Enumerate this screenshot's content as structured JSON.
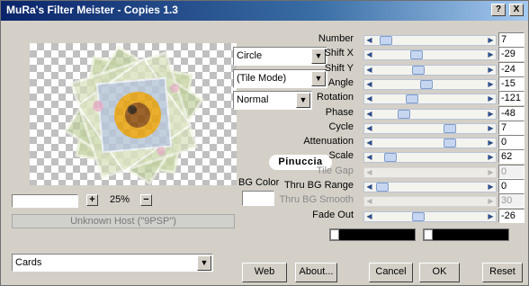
{
  "window": {
    "title": "MuRa's Filter Meister - Copies 1.3"
  },
  "titlebar_buttons": {
    "help": "?",
    "close": "X"
  },
  "zoom": {
    "plus": "+",
    "value": "25%",
    "minus": "−"
  },
  "host_status": "Unknown Host (\"9PSP\")",
  "shape_select": {
    "value": "Circle"
  },
  "mode_select": {
    "value": "(Tile Mode)"
  },
  "blend_select": {
    "value": "Normal"
  },
  "bg_color": {
    "label": "BG Color",
    "value": "#ffffff"
  },
  "watermark": "Pinuccia",
  "params": [
    {
      "label": "Number",
      "value": "7",
      "fraction": 0.05,
      "enabled": true
    },
    {
      "label": "Shift X",
      "value": "-29",
      "fraction": 0.36,
      "enabled": true
    },
    {
      "label": "Shift Y",
      "value": "-24",
      "fraction": 0.38,
      "enabled": true
    },
    {
      "label": "Angle",
      "value": "-15",
      "fraction": 0.46,
      "enabled": true
    },
    {
      "label": "Rotation",
      "value": "-121",
      "fraction": 0.32,
      "enabled": true
    },
    {
      "label": "Phase",
      "value": "-48",
      "fraction": 0.24,
      "enabled": true
    },
    {
      "label": "Cycle",
      "value": "7",
      "fraction": 0.7,
      "enabled": true
    },
    {
      "label": "Attenuation",
      "value": "0",
      "fraction": 0.7,
      "enabled": true
    },
    {
      "label": "Scale",
      "value": "62",
      "fraction": 0.1,
      "enabled": true
    },
    {
      "label": "Tile Gap",
      "value": "0",
      "fraction": 0.0,
      "enabled": false
    },
    {
      "label": "Thru BG Range",
      "value": "0",
      "fraction": 0.02,
      "enabled": true
    },
    {
      "label": "Thru BG Smooth",
      "value": "30",
      "fraction": 0.0,
      "enabled": false
    },
    {
      "label": "Fade Out",
      "value": "-26",
      "fraction": 0.38,
      "enabled": true
    }
  ],
  "preset_select": {
    "value": "Cards"
  },
  "buttons": {
    "web": "Web",
    "about": "About...",
    "cancel": "Cancel",
    "ok": "OK",
    "reset": "Reset"
  }
}
